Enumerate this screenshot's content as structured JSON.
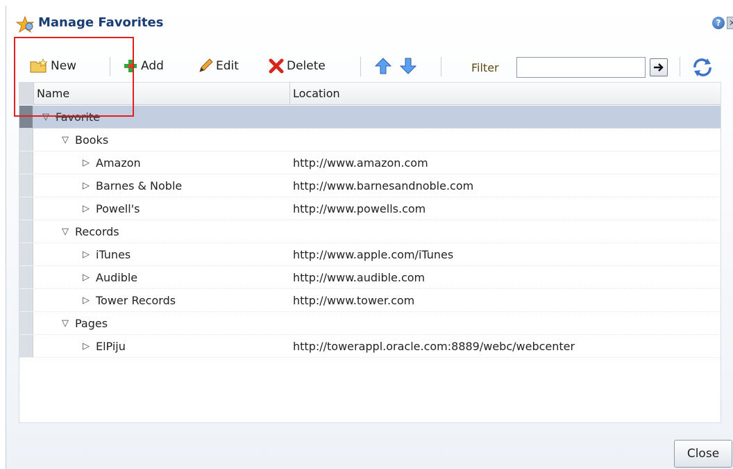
{
  "dialog": {
    "title": "Manage Favorites",
    "help_glyph": "?",
    "close_glyph": "✕"
  },
  "toolbar": {
    "new_label": "New",
    "add_label": "Add",
    "edit_label": "Edit",
    "delete_label": "Delete",
    "filter_label": "Filter",
    "filter_value": ""
  },
  "table": {
    "columns": [
      "Name",
      "Location"
    ],
    "rows": [
      {
        "name": "Favorite",
        "location": "",
        "level": 0,
        "expanded": true,
        "selected": true
      },
      {
        "name": "Books",
        "location": "",
        "level": 1,
        "expanded": true
      },
      {
        "name": "Amazon",
        "location": "http://www.amazon.com",
        "level": 2
      },
      {
        "name": "Barnes & Noble",
        "location": "http://www.barnesandnoble.com",
        "level": 2
      },
      {
        "name": "Powell's",
        "location": "http://www.powells.com",
        "level": 2
      },
      {
        "name": "Records",
        "location": "",
        "level": 1,
        "expanded": true
      },
      {
        "name": "iTunes",
        "location": "http://www.apple.com/iTunes",
        "level": 2
      },
      {
        "name": "Audible",
        "location": "http://www.audible.com",
        "level": 2
      },
      {
        "name": "Tower Records",
        "location": "http://www.tower.com",
        "level": 2
      },
      {
        "name": "Pages",
        "location": "",
        "level": 1,
        "expanded": true
      },
      {
        "name": "ElPiju",
        "location": "http://towerappl.oracle.com:8889/webc/webcenter",
        "level": 2
      }
    ]
  },
  "footer": {
    "close_label": "Close"
  },
  "colors": {
    "title": "#1a3d73",
    "highlight": "#e02020",
    "selected_row": "#c3cfe0"
  }
}
